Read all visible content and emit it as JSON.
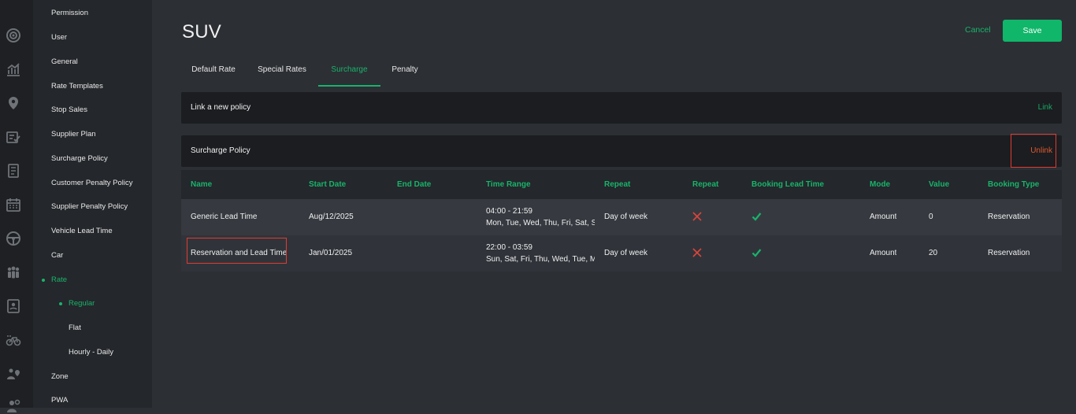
{
  "colors": {
    "accent": "#19b36b",
    "save_bg": "#10b66a",
    "unlink": "#e0592f",
    "highlight_border": "#e03b32",
    "x_mark": "#e0443a"
  },
  "rail_icons": [
    "target-icon",
    "analytics-icon",
    "location-pin-icon",
    "checklist-icon",
    "document-icon",
    "calendar-icon",
    "steering-wheel-icon",
    "people-group-icon",
    "id-card-icon",
    "bicycle-icon",
    "user-location-icon",
    "user-settings-icon"
  ],
  "sidebar": {
    "items": [
      {
        "label": "Permission"
      },
      {
        "label": "User"
      },
      {
        "label": "General"
      },
      {
        "label": "Rate Templates"
      },
      {
        "label": "Stop Sales"
      },
      {
        "label": "Supplier Plan"
      },
      {
        "label": "Surcharge Policy"
      },
      {
        "label": "Customer Penalty Policy"
      },
      {
        "label": "Supplier Penalty Policy"
      },
      {
        "label": "Vehicle Lead Time"
      },
      {
        "label": "Car"
      },
      {
        "label": "Rate"
      },
      {
        "label": "Regular"
      },
      {
        "label": "Flat"
      },
      {
        "label": "Hourly - Daily"
      },
      {
        "label": "Zone"
      },
      {
        "label": "PWA"
      }
    ]
  },
  "header": {
    "title": "SUV",
    "cancel_label": "Cancel",
    "save_label": "Save"
  },
  "tabs": [
    {
      "label": "Default Rate"
    },
    {
      "label": "Special Rates"
    },
    {
      "label": "Surcharge"
    },
    {
      "label": "Penalty"
    }
  ],
  "link_bar": {
    "label": "Link a new policy",
    "action": "Link"
  },
  "policy_bar": {
    "label": "Surcharge Policy",
    "action": "Unlink"
  },
  "table": {
    "headers": [
      "Name",
      "Start Date",
      "End Date",
      "Time Range",
      "Repeat",
      "Repeat",
      "Booking Lead Time",
      "Mode",
      "Value",
      "Booking Type"
    ],
    "rows": [
      {
        "name": "Generic Lead Time",
        "start": "Aug/12/2025",
        "end": "",
        "time": "04:00 - 21:59",
        "days": "Mon, Tue, Wed, Thu, Fri, Sat, Sun",
        "repeat": "Day of week",
        "repeat_flag": "x-icon",
        "lead_time": "check-icon",
        "mode": "Amount",
        "value": "0",
        "booking_type": "Reservation"
      },
      {
        "name": "Reservation and Lead Time",
        "start": "Jan/01/2025",
        "end": "",
        "time": "22:00 - 03:59",
        "days": "Sun, Sat, Fri, Thu, Wed, Tue, Mon",
        "repeat": "Day of week",
        "repeat_flag": "x-icon",
        "lead_time": "check-icon",
        "mode": "Amount",
        "value": "20",
        "booking_type": "Reservation"
      }
    ]
  }
}
